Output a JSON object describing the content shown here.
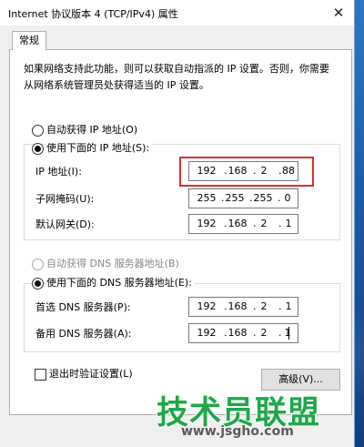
{
  "window": {
    "title": "Internet 协议版本 4 (TCP/IPv4) 属性",
    "close_glyph": "✕"
  },
  "tabs": [
    {
      "label": "常规"
    }
  ],
  "description": "如果网络支持此功能，则可以获取自动指派的 IP 设置。否则，你需要从网络系统管理员处获得适当的 IP 设置。",
  "ip_section": {
    "auto_label": "自动获得 IP 地址(O)",
    "manual_label": "使用下面的 IP 地址(S):",
    "selected": "manual",
    "fields": [
      {
        "label": "IP 地址(I):",
        "octets": [
          "192",
          "168",
          "2",
          "88"
        ]
      },
      {
        "label": "子网掩码(U):",
        "octets": [
          "255",
          "255",
          "255",
          "0"
        ]
      },
      {
        "label": "默认网关(D):",
        "octets": [
          "192",
          "168",
          "2",
          "1"
        ]
      }
    ]
  },
  "dns_section": {
    "auto_label": "自动获得 DNS 服务器地址(B)",
    "manual_label": "使用下面的 DNS 服务器地址(E):",
    "selected": "manual",
    "auto_disabled": true,
    "fields": [
      {
        "label": "首选 DNS 服务器(P):",
        "octets": [
          "192",
          "168",
          "2",
          "1"
        ]
      },
      {
        "label": "备用 DNS 服务器(A):",
        "octets": [
          "192",
          "168",
          "2",
          "1"
        ]
      }
    ]
  },
  "validate_on_exit": {
    "label": "退出时验证设置(L)",
    "checked": false
  },
  "advanced_button": "高级(V)...",
  "watermark": {
    "brand": "技术员联盟",
    "url": "www.jsgho.com"
  },
  "colors": {
    "highlight_border": "#d7312b",
    "watermark_green": "#1fa84a"
  }
}
